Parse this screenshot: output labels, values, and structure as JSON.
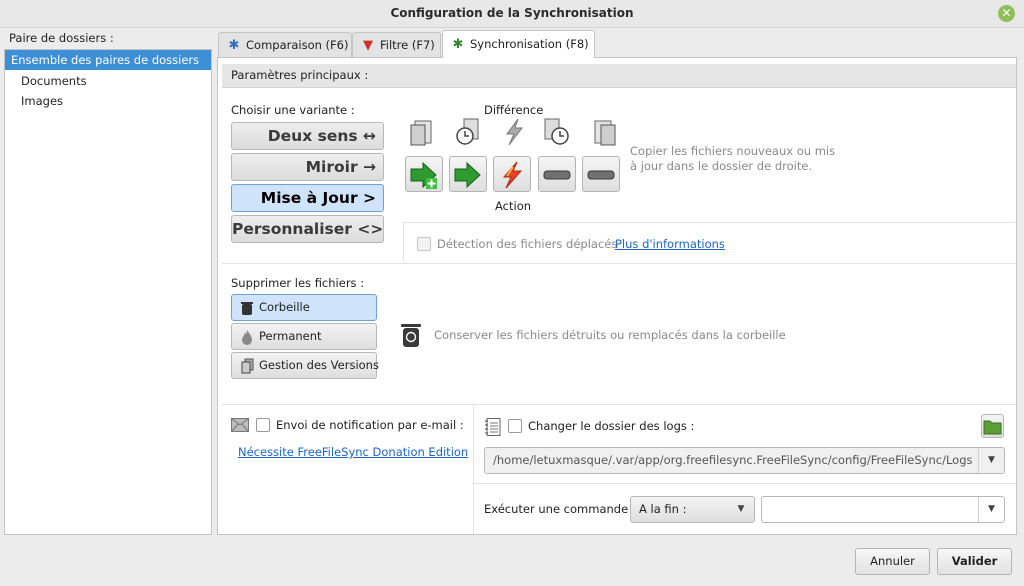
{
  "window": {
    "title": "Configuration de la Synchronisation"
  },
  "pairs": {
    "label": "Paire de dossiers :",
    "items": [
      "Ensemble des paires de dossiers",
      "Documents",
      "Images"
    ]
  },
  "tabs": [
    {
      "label": "Comparaison (F6)",
      "icon": "gear-icon"
    },
    {
      "label": "Filtre (F7)",
      "icon": "filter-icon"
    },
    {
      "label": "Synchronisation (F8)",
      "icon": "gear-icon",
      "active": true
    }
  ],
  "main": {
    "section_title": "Paramètres principaux :",
    "variant_label": "Choisir une variante :",
    "variants": [
      "Deux sens ↔",
      "Miroir →",
      "Mise à Jour >",
      "Personnaliser <>"
    ],
    "selected_variant": "Mise à Jour >",
    "difference_label": "Différence",
    "action_label": "Action",
    "description": "Copier les fichiers nouveaux ou mis à jour dans le dossier de droite.",
    "detect_moved_label": "Détection des fichiers déplacés",
    "more_info_link": "Plus d'informations",
    "delete_label": "Supprimer les fichiers :",
    "delete_options": [
      "Corbeille",
      "Permanent",
      "Gestion des Versions"
    ],
    "delete_selected": "Corbeille",
    "delete_description": "Conserver les fichiers détruits ou remplacés dans la corbeille",
    "email_label": "Envoi de notification par e-mail :",
    "email_link": "Nécessite FreeFileSync Donation Edition",
    "logs_label": "Changer le dossier des logs :",
    "logs_path": "/home/letuxmasque/.var/app/org.freefilesync.FreeFileSync/config/FreeFileSync/Logs",
    "command_label": "Exécuter une commande :",
    "command_timing": "A la fin :",
    "command_value": ""
  },
  "footer": {
    "cancel": "Annuler",
    "ok": "Valider"
  },
  "colors": {
    "accent": "#3d8fd6",
    "selected_button": "#cfe4fb",
    "link": "#1a66c4",
    "green_action": "#2e9b2e"
  }
}
